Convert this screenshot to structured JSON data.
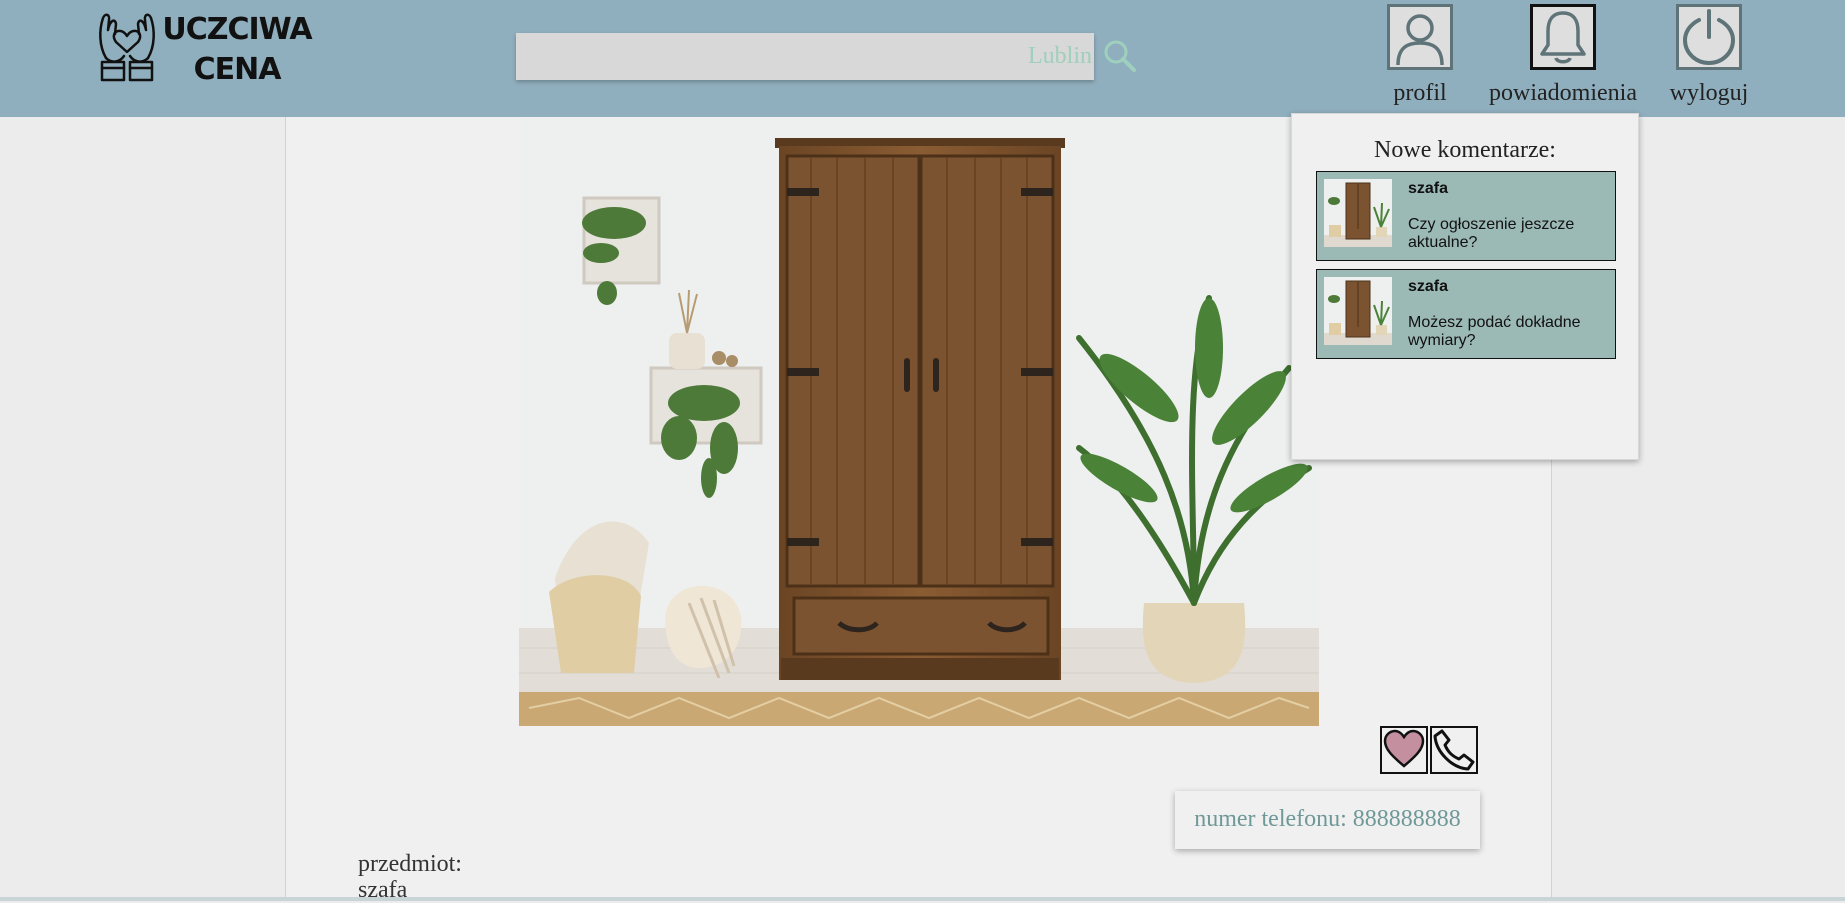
{
  "brand": {
    "logo_line1": "UCZCIWA",
    "logo_line2": "CENA"
  },
  "search": {
    "value": "Lublin",
    "icon": "search-icon"
  },
  "nav": {
    "profile": {
      "label": "profil",
      "icon": "user-icon"
    },
    "notifications": {
      "label": "powiadomienia",
      "icon": "bell-icon"
    },
    "logout": {
      "label": "wyloguj",
      "icon": "power-icon"
    }
  },
  "listing": {
    "image_subject": "wooden wardrobe",
    "phone_text": "numer telefonu: 888888888",
    "subject_label": "przedmiot:",
    "subject_value": "szafa",
    "actions": {
      "favorite_icon": "heart-icon",
      "call_icon": "phone-icon"
    }
  },
  "notifications_panel": {
    "title": "Nowe komentarze:",
    "items": [
      {
        "name": "szafa",
        "text": "Czy ogłoszenie jeszcze aktualne?"
      },
      {
        "name": "szafa",
        "text": "Możesz podać dokładne wymiary?"
      }
    ]
  },
  "colors": {
    "header": "#90afbe",
    "page_bg": "#ececec",
    "content_bg": "#f0f0f0",
    "notif_item_bg": "#9bb9b5",
    "accent_text": "#6f9898",
    "heart_fill": "#c4909f"
  }
}
